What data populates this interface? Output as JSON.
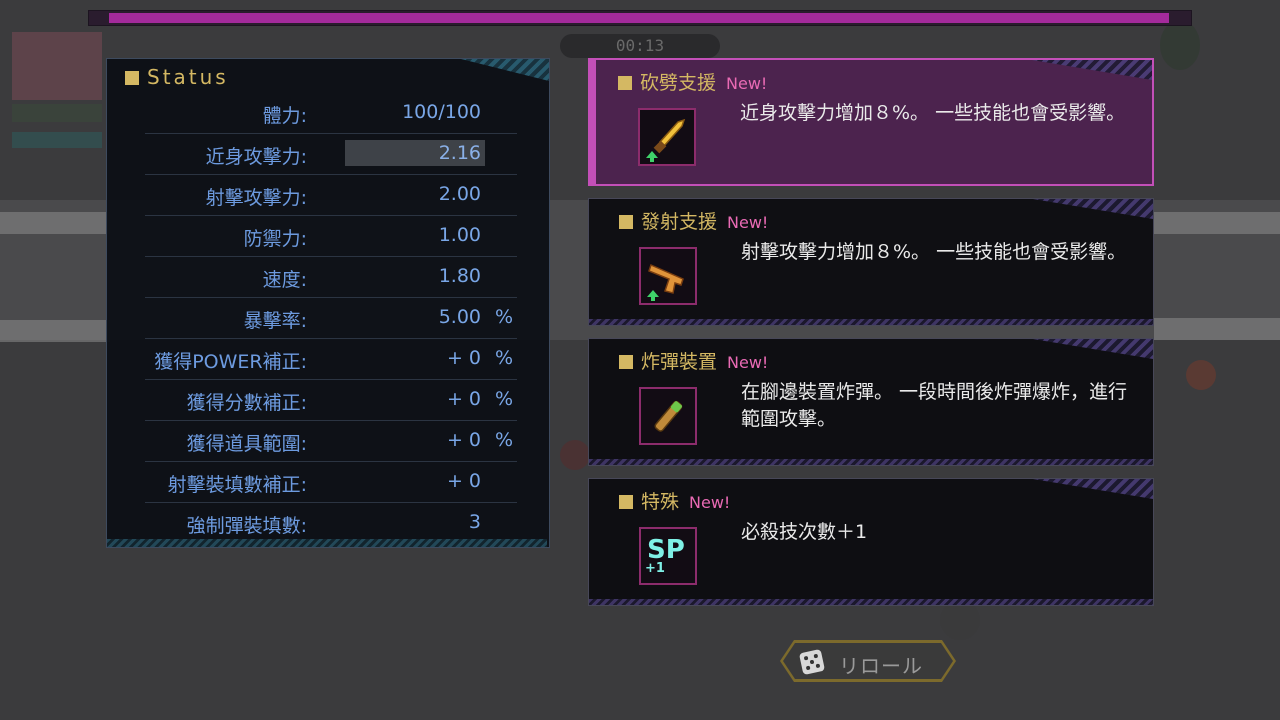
{
  "hud": {
    "timer": "00:13"
  },
  "status": {
    "title": "Status",
    "rows": [
      {
        "label": "體力:",
        "value": "100/100",
        "unit": ""
      },
      {
        "label": "近身攻擊力:",
        "value": "2.16",
        "unit": ""
      },
      {
        "label": "射擊攻擊力:",
        "value": "2.00",
        "unit": ""
      },
      {
        "label": "防禦力:",
        "value": "1.00",
        "unit": ""
      },
      {
        "label": "速度:",
        "value": "1.80",
        "unit": ""
      },
      {
        "label": "暴擊率:",
        "value": "5.00",
        "unit": "%"
      },
      {
        "label": "獲得POWER補正:",
        "value": "+ 0",
        "unit": "%"
      },
      {
        "label": "獲得分數補正:",
        "value": "+ 0",
        "unit": "%"
      },
      {
        "label": "獲得道具範圍:",
        "value": "+ 0",
        "unit": "%"
      },
      {
        "label": "射擊裝填數補正:",
        "value": "+ 0",
        "unit": ""
      },
      {
        "label": "強制彈裝填數:",
        "value": "3",
        "unit": ""
      }
    ]
  },
  "cards": [
    {
      "title": "砍劈支援",
      "badge": "New!",
      "description": "近身攻擊力增加８%。 一些技能也會受影響。",
      "icon": "knife-icon",
      "selected": true
    },
    {
      "title": "發射支援",
      "badge": "New!",
      "description": "射擊攻擊力增加８%。 一些技能也會受影響。",
      "icon": "pistol-icon",
      "selected": false
    },
    {
      "title": "炸彈裝置",
      "badge": "New!",
      "description": "在腳邊裝置炸彈。 一段時間後炸彈爆炸，進行範圍攻擊。",
      "icon": "bomb-stick-icon",
      "selected": false
    },
    {
      "title": "特殊",
      "badge": "New!",
      "description": "必殺技次數＋1",
      "icon": "sp-plus-one-icon",
      "selected": false,
      "icon_text": "SP",
      "icon_subtext": "+1"
    }
  ],
  "reroll": {
    "label": "リロール",
    "icon": "dice-icon"
  },
  "colors": {
    "accent_gold": "#d4b863",
    "stat_blue": "#6d9be0",
    "new_pink": "#e96ab4",
    "selected_magenta": "#c34fb8"
  }
}
